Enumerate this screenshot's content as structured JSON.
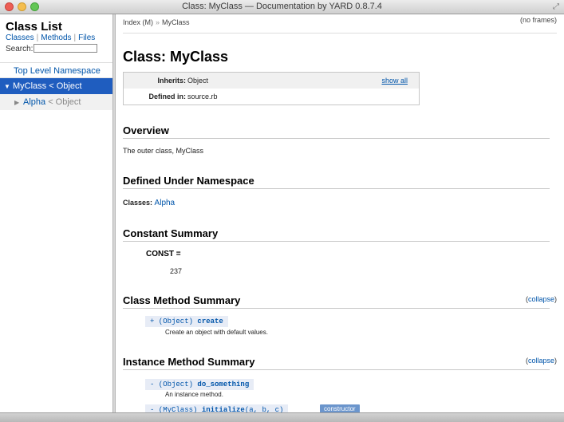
{
  "window": {
    "title": "Class: MyClass — Documentation by YARD 0.8.7.4"
  },
  "sidebar": {
    "title": "Class List",
    "nav": [
      "Classes",
      "Methods",
      "Files"
    ],
    "search_label": "Search:",
    "search_value": "",
    "items": [
      {
        "label": "Top Level Namespace",
        "suffix": ""
      },
      {
        "label": "MyClass",
        "suffix": "< Object"
      },
      {
        "label": "Alpha",
        "suffix": "< Object"
      }
    ]
  },
  "header": {
    "breadcrumb": [
      "Index (M)",
      "MyClass"
    ],
    "breadcrumb_sep": "»",
    "no_frames": "(no frames)"
  },
  "page": {
    "title": "Class: MyClass",
    "inherits_label": "Inherits:",
    "inherits_value": "Object",
    "show_all": "show all",
    "defined_label": "Defined in:",
    "defined_value": "source.rb"
  },
  "overview": {
    "heading": "Overview",
    "text": "The outer class, MyClass"
  },
  "namespace": {
    "heading": "Defined Under Namespace",
    "classes_label": "Classes:",
    "classes_link": "Alpha"
  },
  "constants": {
    "heading": "Constant Summary",
    "name": "CONST =",
    "value": "237"
  },
  "class_methods": {
    "heading": "Class Method Summary",
    "collapse": "collapse",
    "items": [
      {
        "prefix": "+ (Object)",
        "name": "create",
        "args": "",
        "desc": "Create an object with default values."
      }
    ]
  },
  "instance_methods": {
    "heading": "Instance Method Summary",
    "collapse": "collapse",
    "items": [
      {
        "prefix": "- (Object)",
        "name": "do_something",
        "args": "",
        "desc": "An instance method."
      },
      {
        "prefix": "- (MyClass)",
        "name": "initialize",
        "args": "(a, b, c)",
        "desc": "",
        "badge": "constructor"
      }
    ]
  }
}
